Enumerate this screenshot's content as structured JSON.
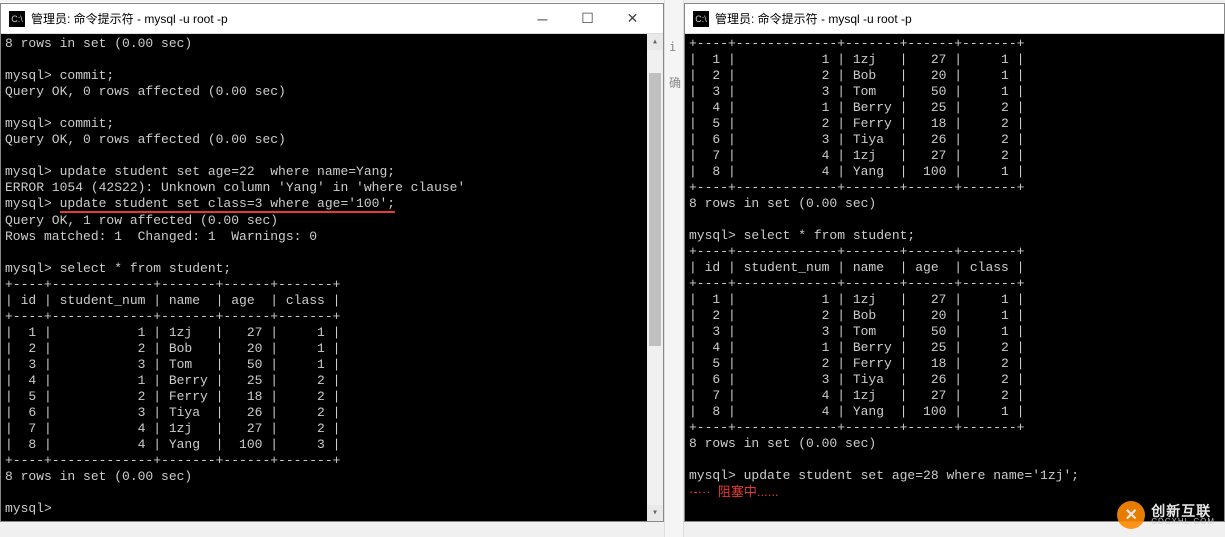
{
  "watermark": {
    "cn": "创新互联",
    "py": "CDCXHL.COM"
  },
  "left_window": {
    "title": "管理员: 命令提示符 - mysql  -u root -p",
    "icon_text": "C:\\",
    "output": {
      "l1": "8 rows in set (0.00 sec)",
      "l2": "",
      "l3": "mysql> commit;",
      "l4": "Query OK, 0 rows affected (0.00 sec)",
      "l5": "",
      "l6": "mysql> commit;",
      "l7": "Query OK, 0 rows affected (0.00 sec)",
      "l8": "",
      "l9": "mysql> update student set age=22  where name=Yang;",
      "l10": "ERROR 1054 (42S22): Unknown column 'Yang' in 'where clause'",
      "underlined_cmd": "update student set class=3 where age='100';",
      "l11a": "mysql> ",
      "l12": "Query OK, 1 row affected (0.00 sec)",
      "l13": "Rows matched: 1  Changed: 1  Warnings: 0",
      "l14": "",
      "l15": "mysql> select * from student;",
      "sep": "+----+-------------+-------+------+-------+",
      "hdr": "| id | student_num | name  | age  | class |",
      "rows": [
        "|  1 |           1 | 1zj   |   27 |     1 |",
        "|  2 |           2 | Bob   |   20 |     1 |",
        "|  3 |           3 | Tom   |   50 |     1 |",
        "|  4 |           1 | Berry |   25 |     2 |",
        "|  5 |           2 | Ferry |   18 |     2 |",
        "|  6 |           3 | Tiya  |   26 |     2 |",
        "|  7 |           4 | 1zj   |   27 |     2 |",
        "|  8 |           4 | Yang  |  100 |     3 |"
      ],
      "l16": "8 rows in set (0.00 sec)",
      "l17": "",
      "l18": "mysql>"
    },
    "table_data": {
      "columns": [
        "id",
        "student_num",
        "name",
        "age",
        "class"
      ],
      "rows": [
        {
          "id": 1,
          "student_num": 1,
          "name": "1zj",
          "age": 27,
          "class": 1
        },
        {
          "id": 2,
          "student_num": 2,
          "name": "Bob",
          "age": 20,
          "class": 1
        },
        {
          "id": 3,
          "student_num": 3,
          "name": "Tom",
          "age": 50,
          "class": 1
        },
        {
          "id": 4,
          "student_num": 1,
          "name": "Berry",
          "age": 25,
          "class": 2
        },
        {
          "id": 5,
          "student_num": 2,
          "name": "Ferry",
          "age": 18,
          "class": 2
        },
        {
          "id": 6,
          "student_num": 3,
          "name": "Tiya",
          "age": 26,
          "class": 2
        },
        {
          "id": 7,
          "student_num": 4,
          "name": "1zj",
          "age": 27,
          "class": 2
        },
        {
          "id": 8,
          "student_num": 4,
          "name": "Yang",
          "age": 100,
          "class": 3
        }
      ]
    }
  },
  "right_window": {
    "title": "管理员: 命令提示符 - mysql  -u root -p",
    "icon_text": "C:\\",
    "output": {
      "sep": "+----+-------------+-------+------+-------+",
      "rows1": [
        "|  1 |           1 | 1zj   |   27 |     1 |",
        "|  2 |           2 | Bob   |   20 |     1 |",
        "|  3 |           3 | Tom   |   50 |     1 |",
        "|  4 |           1 | Berry |   25 |     2 |",
        "|  5 |           2 | Ferry |   18 |     2 |",
        "|  6 |           3 | Tiya  |   26 |     2 |",
        "|  7 |           4 | 1zj   |   27 |     2 |",
        "|  8 |           4 | Yang  |  100 |     1 |"
      ],
      "l1": "8 rows in set (0.00 sec)",
      "l2": "",
      "l3": "mysql> select * from student;",
      "hdr": "| id | student_num | name  | age  | class |",
      "rows2": [
        "|  1 |           1 | 1zj   |   27 |     1 |",
        "|  2 |           2 | Bob   |   20 |     1 |",
        "|  3 |           3 | Tom   |   50 |     1 |",
        "|  4 |           1 | Berry |   25 |     2 |",
        "|  5 |           2 | Ferry |   18 |     2 |",
        "|  6 |           3 | Tiya  |   26 |     2 |",
        "|  7 |           4 | 1zj   |   27 |     2 |",
        "|  8 |           4 | Yang  |  100 |     1 |"
      ],
      "l4": "8 rows in set (0.00 sec)",
      "l5": "",
      "l6": "mysql> update student set age=28 where name='1zj';",
      "annot_prefix": "·-···  ",
      "annot": "阻塞中......"
    },
    "table_data": {
      "columns": [
        "id",
        "student_num",
        "name",
        "age",
        "class"
      ],
      "rows": [
        {
          "id": 1,
          "student_num": 1,
          "name": "1zj",
          "age": 27,
          "class": 1
        },
        {
          "id": 2,
          "student_num": 2,
          "name": "Bob",
          "age": 20,
          "class": 1
        },
        {
          "id": 3,
          "student_num": 3,
          "name": "Tom",
          "age": 50,
          "class": 1
        },
        {
          "id": 4,
          "student_num": 1,
          "name": "Berry",
          "age": 25,
          "class": 2
        },
        {
          "id": 5,
          "student_num": 2,
          "name": "Ferry",
          "age": 18,
          "class": 2
        },
        {
          "id": 6,
          "student_num": 3,
          "name": "Tiya",
          "age": 26,
          "class": 2
        },
        {
          "id": 7,
          "student_num": 4,
          "name": "1zj",
          "age": 27,
          "class": 2
        },
        {
          "id": 8,
          "student_num": 4,
          "name": "Yang",
          "age": 100,
          "class": 1
        }
      ]
    }
  }
}
